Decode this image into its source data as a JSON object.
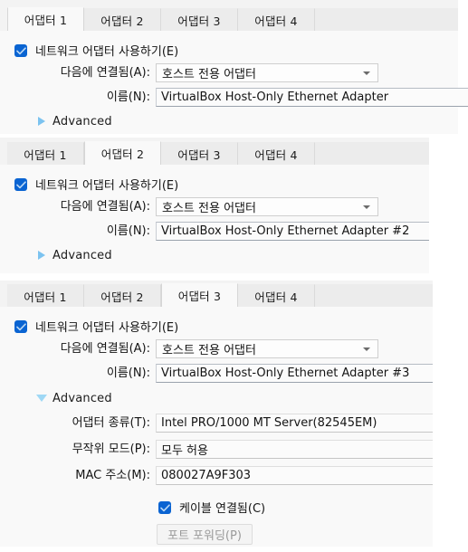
{
  "common": {
    "tabs": [
      "어댑터 1",
      "어댑터 2",
      "어댑터 3",
      "어댑터 4"
    ],
    "enable_adapter_label": "네트워크 어댑터 사용하기(E)",
    "attached_to_label": "다음에 연결됨(A):",
    "name_label": "이름(N):",
    "advanced_label": "Advanced",
    "attached_to_value": "호스트 전용 어댑터",
    "accent_blue": "#0a64d2",
    "triangle_blue": "#7cc3f0"
  },
  "panels": [
    {
      "active_tab_index": 0,
      "enable_adapter_checked": true,
      "attached_to": "호스트 전용 어댑터",
      "name": "VirtualBox Host-Only Ethernet Adapter",
      "advanced_expanded": false
    },
    {
      "active_tab_index": 1,
      "enable_adapter_checked": true,
      "attached_to": "호스트 전용 어댑터",
      "name": "VirtualBox Host-Only Ethernet Adapter #2",
      "advanced_expanded": false
    },
    {
      "active_tab_index": 2,
      "enable_adapter_checked": true,
      "attached_to": "호스트 전용 어댑터",
      "name": "VirtualBox Host-Only Ethernet Adapter #3",
      "advanced_expanded": true,
      "advanced": {
        "adapter_type_label": "어댑터 종류(T):",
        "adapter_type_value": "Intel PRO/1000 MT Server(82545EM)",
        "promiscuous_label": "무작위 모드(P):",
        "promiscuous_value": "모두 허용",
        "mac_label": "MAC 주소(M):",
        "mac_value": "080027A9F303",
        "cable_connected_label": "케이블 연결됨(C)",
        "cable_connected_checked": true,
        "port_forwarding_label": "포트 포워딩(P)",
        "port_forwarding_enabled": false
      }
    }
  ]
}
